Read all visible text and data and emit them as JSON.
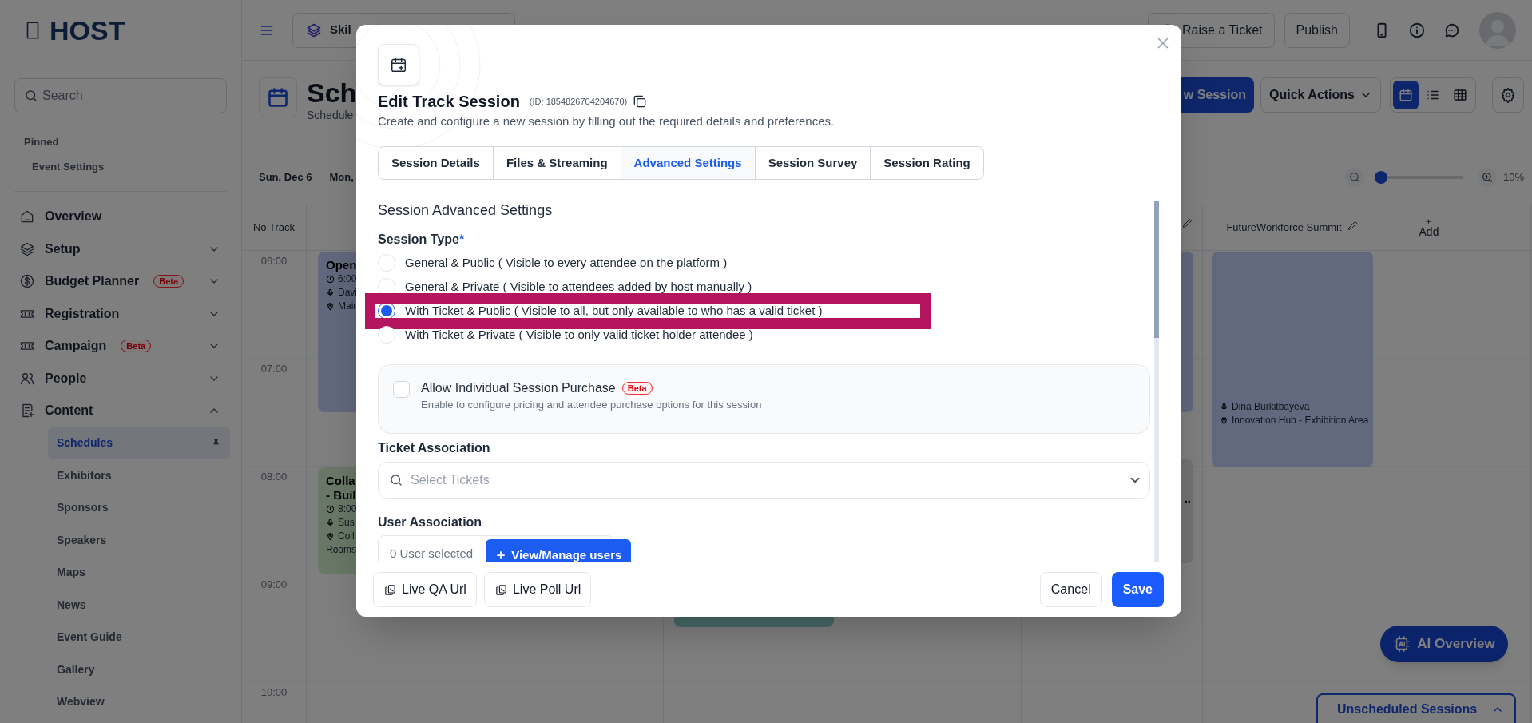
{
  "sidebar": {
    "logo": "HOST",
    "search": {
      "placeholder": "Search"
    },
    "pinned": {
      "heading": "Pinned",
      "items": [
        "Event Settings"
      ]
    },
    "nav": [
      {
        "label": "Overview"
      },
      {
        "label": "Setup",
        "expanded": false
      },
      {
        "label": "Budget Planner",
        "badge": "Beta",
        "expanded": false
      },
      {
        "label": "Registration",
        "expanded": false
      },
      {
        "label": "Campaign",
        "badge": "Beta",
        "expanded": false
      },
      {
        "label": "People",
        "expanded": false
      },
      {
        "label": "Content",
        "expanded": true,
        "children": [
          {
            "label": "Schedules",
            "selected": true
          },
          {
            "label": "Exhibitors",
            "selected": false
          },
          {
            "label": "Sponsors",
            "selected": false
          },
          {
            "label": "Speakers",
            "selected": false
          },
          {
            "label": "Maps",
            "selected": false
          },
          {
            "label": "News",
            "selected": false
          },
          {
            "label": "Event Guide",
            "selected": false
          },
          {
            "label": "Gallery",
            "selected": false
          },
          {
            "label": "Webview",
            "selected": false
          }
        ]
      }
    ]
  },
  "topbar": {
    "event_selector": {
      "label": "Skil"
    },
    "buttons": [
      "Raise a Ticket",
      "Publish"
    ]
  },
  "page_header": {
    "title": "Sch",
    "subtitle": "Schedule",
    "new_session_button": "w Session",
    "quick_actions": "Quick Actions",
    "view_modes": [
      {
        "selected": true
      },
      {
        "selected": false
      },
      {
        "selected": false
      }
    ]
  },
  "date_bar": {
    "dates": [
      "Sun, Dec 6",
      "Mon,"
    ],
    "zoom": {
      "level": 0.03,
      "reading": "10%"
    }
  },
  "calendar": {
    "columns": [
      "No Track",
      "FutureWorkforce Summit"
    ],
    "add_column": "Add",
    "times": [
      "06:00",
      "07:00",
      "08:00",
      "09:00",
      "10:00"
    ],
    "events": [
      {
        "title_lines": [
          "Open"
        ],
        "time": "6:00",
        "speaker": "Davi",
        "location_lines": [
          "Main"
        ]
      },
      {
        "title_lines": [
          "Colla",
          "- Buil"
        ],
        "time": "8:00",
        "speaker": "Sus",
        "location_lines": [
          "Coll",
          "Rooms"
        ]
      },
      {
        "title_lines": [
          ".."
        ]
      },
      {
        "speaker": "Dina Burkitbayeva",
        "location_lines": [
          "Innovation Hub - Exhibition Area"
        ]
      }
    ]
  },
  "modal": {
    "title": "Edit Track Session",
    "id_label": "(ID: 1854826704204670)",
    "description": "Create and configure a new session by filling out the required details and preferences.",
    "tabs": [
      {
        "label": "Session Details",
        "selected": false
      },
      {
        "label": "Files & Streaming",
        "selected": false
      },
      {
        "label": "Advanced Settings",
        "selected": true
      },
      {
        "label": "Session Survey",
        "selected": false
      },
      {
        "label": "Session Rating",
        "selected": false
      }
    ],
    "section_title": "Session Advanced Settings",
    "session_type": {
      "label": "Session Type",
      "required_mark": "*",
      "options": [
        {
          "label": "General & Public ( Visible to every attendee on the platform )",
          "selected": false,
          "highlighted": false
        },
        {
          "label": "General & Private ( Visible to attendees added by host manually )",
          "selected": false,
          "highlighted": false
        },
        {
          "label": "With Ticket & Public ( Visible to all, but only available to who has a valid ticket )",
          "selected": true,
          "highlighted": true
        },
        {
          "label": "With Ticket & Private ( Visible to only valid ticket holder attendee )",
          "selected": false,
          "highlighted": false
        }
      ]
    },
    "purchase_option": {
      "title": "Allow Individual Session Purchase",
      "badge": "Beta",
      "description": "Enable to configure pricing and attendee purchase options for this session",
      "checked": false
    },
    "ticket_association": {
      "label": "Ticket Association",
      "placeholder": "Select Tickets"
    },
    "user_association": {
      "label": "User Association",
      "count": "0 User selected",
      "button": "View/Manage users"
    },
    "footer": {
      "link_buttons": [
        "Live QA Url",
        "Live Poll Url"
      ],
      "cancel": "Cancel",
      "save": "Save"
    }
  },
  "floating": {
    "ai_overview": "AI Overview",
    "unscheduled": {
      "label": "Unscheduled Sessions",
      "expanded": false
    }
  }
}
